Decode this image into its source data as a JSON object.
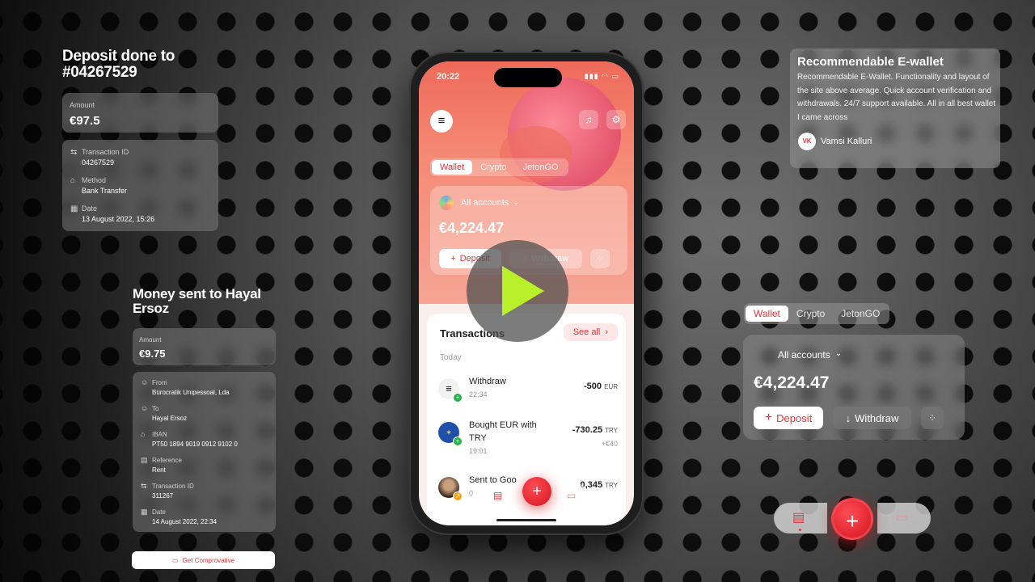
{
  "deposit_card": {
    "title": "Deposit done to #04267529",
    "amount_label": "Amount",
    "amount_value": "€97.5",
    "transaction_id_label": "Transaction ID",
    "transaction_id_value": "04267529",
    "method_label": "Method",
    "method_value": "Bank Transfer",
    "date_label": "Date",
    "date_value": "13 August 2022, 15:26"
  },
  "money_sent_card": {
    "title": "Money sent to Hayal Ersoz",
    "amount_label": "Amount",
    "amount_value": "€9.75",
    "from_label": "From",
    "from_value": "Bürocratik Unipessoal, Lda",
    "to_label": "To",
    "to_value": "Hayal Ersoz",
    "iban_label": "IBAN",
    "iban_value": "PT50 1894 9019 0912 9102 0",
    "reference_label": "Reference",
    "reference_value": "Rent",
    "transaction_id_label": "Transaction ID",
    "transaction_id_value": "311267",
    "date_label": "Date",
    "date_value": "14 August 2022, 22:34",
    "button_label": "Get Comprovative"
  },
  "phone": {
    "status_time": "20:22",
    "tabs": [
      "Wallet",
      "Crypto",
      "JetonGO"
    ],
    "accounts_label": "All accounts",
    "balance": "€4,224.47",
    "deposit_label": "Deposit",
    "withdraw_label": "Withdraw",
    "transactions_title": "Transactions",
    "see_all_label": "See all",
    "today_label": "Today",
    "transactions": [
      {
        "name": "Withdraw",
        "time": "22:34",
        "amount": "-500",
        "currency": "EUR",
        "sub": ""
      },
      {
        "name": "Bought EUR with TRY",
        "time": "19:01",
        "amount": "-730.25",
        "currency": "TRY",
        "sub": "+€40"
      },
      {
        "name": "Sent to Goo",
        "time": "0",
        "amount": "0,345",
        "currency": "TRY",
        "sub": ""
      }
    ]
  },
  "review_card": {
    "title": "Recommendable E-wallet",
    "body": "Recommendable E-Wallet. Functionality and layout of the site above average. Quick account verification and withdrawals. 24/7 support available. All in all best wallet I came across",
    "reviewer_initials": "VK",
    "reviewer_name": "Vamsi Kalluri"
  },
  "floating_wallet": {
    "tabs": [
      "Wallet",
      "Crypto",
      "JetonGO"
    ],
    "accounts_label": "All accounts",
    "balance": "€4,224.47",
    "deposit_label": "Deposit",
    "withdraw_label": "Withdraw"
  },
  "colors": {
    "accent_red": "#e0383e",
    "play_green": "#b8f02a"
  }
}
